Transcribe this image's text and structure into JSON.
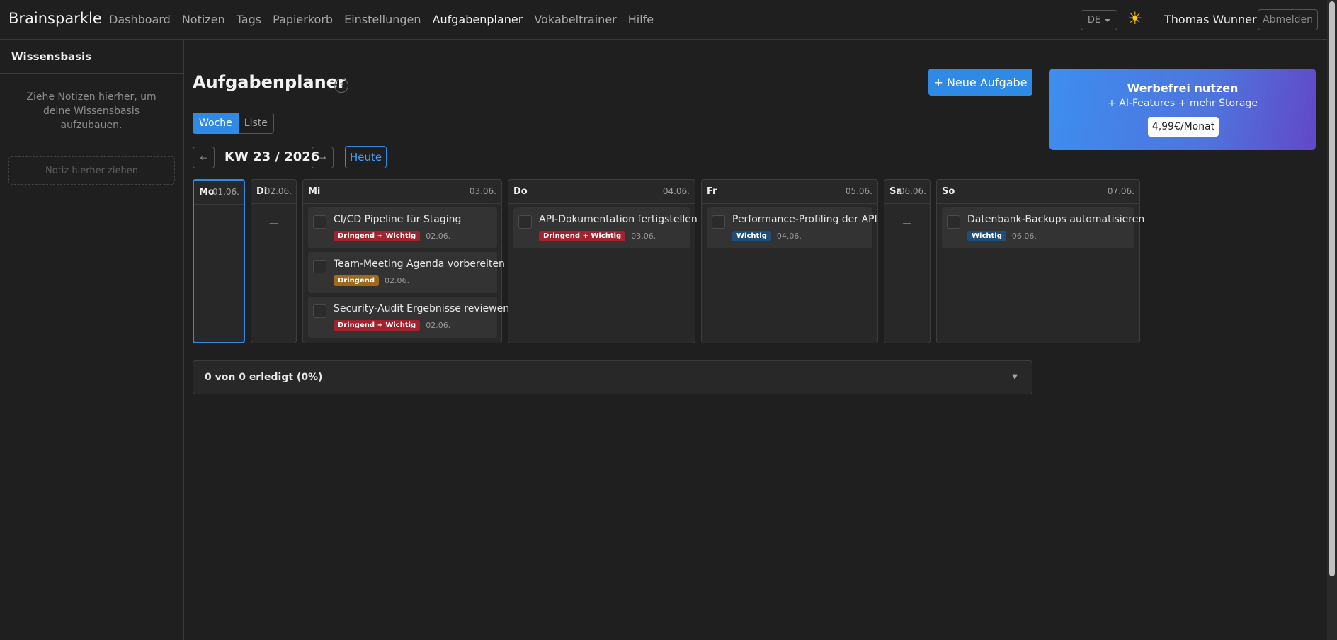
{
  "navbar": {
    "brand": "Brainsparkle",
    "links": [
      {
        "label": "Dashboard"
      },
      {
        "label": "Notizen"
      },
      {
        "label": "Tags"
      },
      {
        "label": "Papierkorb"
      },
      {
        "label": "Einstellungen"
      },
      {
        "label": "Aufgabenplaner"
      },
      {
        "label": "Vokabeltrainer"
      },
      {
        "label": "Hilfe"
      }
    ],
    "active_link": "Aufgabenplaner",
    "language": "DE",
    "theme_icon": "sun-icon",
    "user_name": "Thomas Wunner",
    "logout_label": "Abmelden"
  },
  "sidebar": {
    "title": "Wissensbasis",
    "hint": "Ziehe Notizen hierher, um deine Wissensbasis aufzubauen.",
    "drop_zone": "Notiz hierher ziehen"
  },
  "main": {
    "title": "Aufgabenplaner",
    "help_label": "?",
    "new_task_label": "+ Neue Aufgabe",
    "view_toggle": {
      "week": "Woche",
      "list": "Liste",
      "selected": "Woche"
    },
    "nav": {
      "prev": "←",
      "next": "→",
      "week_label": "KW 23 / 2026",
      "today": "Heute"
    },
    "days": [
      {
        "name": "Mo",
        "date": "01.06.",
        "empty": "—",
        "today": true,
        "tasks": []
      },
      {
        "name": "Di",
        "date": "02.06.",
        "empty": "—",
        "tasks": []
      },
      {
        "name": "Mi",
        "date": "03.06.",
        "tasks": [
          {
            "title": "CI/CD Pipeline für Staging",
            "badge": "Dringend + Wichtig",
            "badge_color": "#a2232d",
            "date": "02.06."
          },
          {
            "title": "Team-Meeting Agenda vorbereiten",
            "badge": "Dringend",
            "badge_color": "#a06a1c",
            "date": "02.06."
          },
          {
            "title": "Security-Audit Ergebnisse reviewen",
            "badge": "Dringend + Wichtig",
            "badge_color": "#a2232d",
            "date": "02.06."
          }
        ]
      },
      {
        "name": "Do",
        "date": "04.06.",
        "tasks": [
          {
            "title": "API-Dokumentation fertigstellen",
            "badge": "Dringend + Wichtig",
            "badge_color": "#a2232d",
            "date": "03.06."
          }
        ]
      },
      {
        "name": "Fr",
        "date": "05.06.",
        "tasks": [
          {
            "title": "Performance-Profiling der API",
            "badge": "Wichtig",
            "badge_color": "#1f4f78",
            "date": "04.06."
          }
        ]
      },
      {
        "name": "Sa",
        "date": "06.06.",
        "empty": "—",
        "tasks": []
      },
      {
        "name": "So",
        "date": "07.06.",
        "tasks": [
          {
            "title": "Datenbank-Backups automatisieren",
            "badge": "Wichtig",
            "badge_color": "#1f4f78",
            "date": "06.06."
          }
        ]
      }
    ],
    "summary": {
      "text": "0 von 0 erledigt (0%)",
      "caret": "▼"
    }
  },
  "ad": {
    "title": "Werbefrei nutzen",
    "subtitle": "+ AI-Features + mehr Storage",
    "price": "4,99€/Monat"
  }
}
